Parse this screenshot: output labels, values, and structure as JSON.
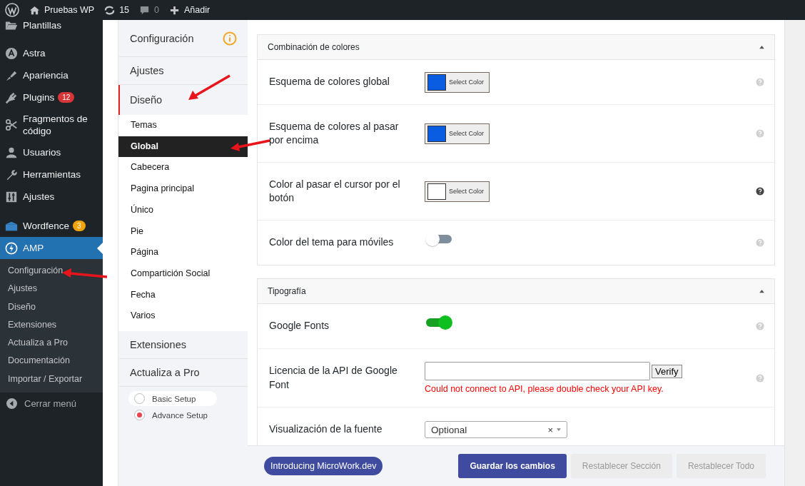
{
  "admin_bar": {
    "site": "Pruebas WP",
    "updates": "15",
    "comments": "0",
    "new": "Añadir"
  },
  "sidebar": {
    "items": [
      {
        "label": "Plantillas",
        "selected": false
      },
      {
        "label": "Astra",
        "selected": false
      },
      {
        "label": "Apariencia",
        "selected": false
      },
      {
        "label": "Plugins",
        "selected": false,
        "badge": {
          "text": "12",
          "color": "#d63638"
        }
      },
      {
        "label": "Fragmentos de código",
        "selected": false
      },
      {
        "label": "Usuarios",
        "selected": false
      },
      {
        "label": "Herramientas",
        "selected": false
      },
      {
        "label": "Ajustes",
        "selected": false
      },
      {
        "label": "Wordfence",
        "selected": false,
        "badge": {
          "text": "3",
          "color": "#f0a30a"
        }
      },
      {
        "label": "AMP",
        "selected": true,
        "submenu": [
          "Configuración",
          "Ajustes",
          "Diseño",
          "Extensiones",
          "Actualiza a Pro",
          "Documentación",
          "Importar / Exportar"
        ]
      }
    ],
    "collapse": "Cerrar menú"
  },
  "options_nav": {
    "sections": [
      {
        "label": "Configuración",
        "selected": false
      },
      {
        "label": "Ajustes",
        "selected": false
      },
      {
        "label": "Diseño",
        "selected": true,
        "children": [
          {
            "label": "Temas",
            "selected": false
          },
          {
            "label": "Global",
            "selected": true
          },
          {
            "label": "Cabecera",
            "selected": false
          },
          {
            "label": "Pagina principal",
            "selected": false
          },
          {
            "label": "Único",
            "selected": false
          },
          {
            "label": "Pie",
            "selected": false
          },
          {
            "label": "Página",
            "selected": false
          },
          {
            "label": "Compartición Social",
            "selected": false
          },
          {
            "label": "Fecha",
            "selected": false
          },
          {
            "label": "Varios",
            "selected": false
          }
        ]
      },
      {
        "label": "Extensiones",
        "selected": false
      },
      {
        "label": "Actualiza a Pro",
        "selected": false
      }
    ],
    "setup": [
      {
        "label": "Basic Setup",
        "selected": false
      },
      {
        "label": "Advance Setup",
        "selected": true
      }
    ]
  },
  "panels": [
    {
      "title": "Combinación de colores",
      "expanded": true,
      "fields": [
        {
          "kind": "color",
          "label": "Esquema de colores global",
          "button": "Select Color",
          "color": "#0a5ce0",
          "help_active": false
        },
        {
          "kind": "color",
          "label": "Esquema de colores al pasar por encima",
          "button": "Select Color",
          "color": "#0a5ce0",
          "help_active": false
        },
        {
          "kind": "color",
          "label": "Color al pasar el cursor por el botón",
          "button": "Select Color",
          "color": "#ffffff",
          "help_active": true
        },
        {
          "kind": "toggle",
          "label": "Color del tema para móviles",
          "on": false,
          "help_active": false
        }
      ]
    },
    {
      "title": "Tipografía",
      "expanded": true,
      "fields": [
        {
          "kind": "toggle",
          "label": "Google Fonts",
          "on": true,
          "help_active": false
        },
        {
          "kind": "text",
          "label": "Licencia de la API de Google Font",
          "button": "Verify",
          "error": "Could not connect to API, please double check your API key.",
          "help_active": false
        },
        {
          "kind": "select",
          "label": "Visualización de la fuente",
          "value": "Optional",
          "clear": "×"
        }
      ]
    }
  ],
  "footer": {
    "promo": "Introducing MicroWork.dev",
    "buttons": [
      {
        "label": "Guardar los cambios",
        "kind": "primary"
      },
      {
        "label": "Restablecer Sección",
        "kind": "secondary"
      },
      {
        "label": "Restablecer Todo",
        "kind": "secondary"
      }
    ]
  }
}
